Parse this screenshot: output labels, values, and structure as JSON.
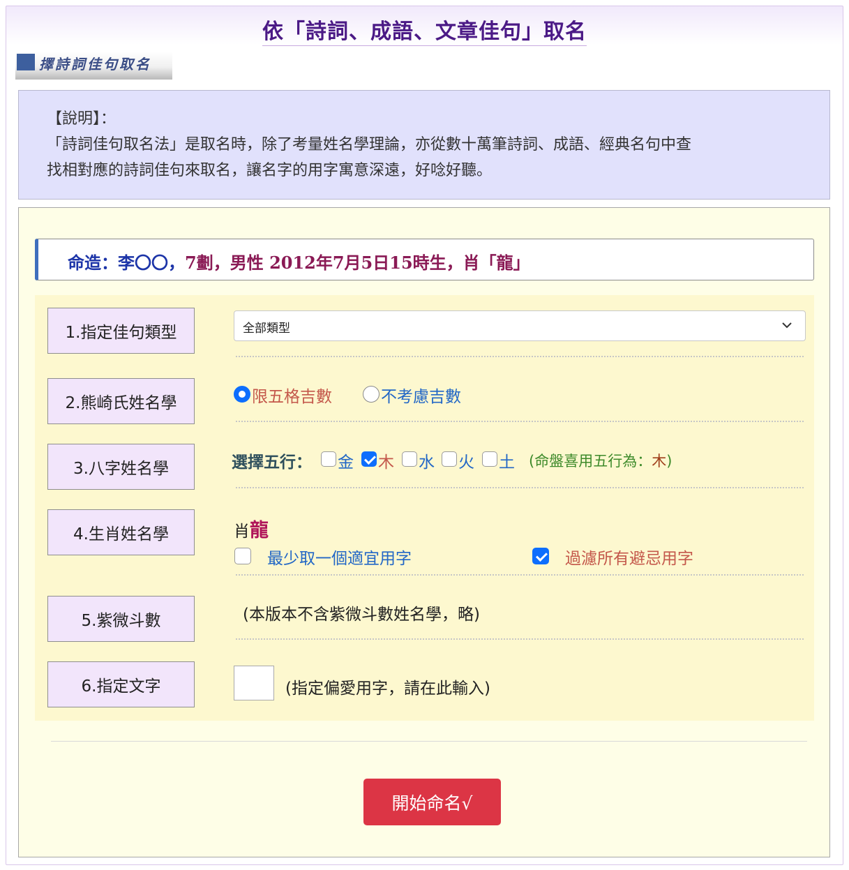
{
  "title": "依「詩詞、成語、文章佳句」取名",
  "banner": {
    "text": "擇詩詞佳句取名"
  },
  "notice": {
    "heading": "【說明】：",
    "line1": "「詩詞佳句取名法」是取名時，除了考量姓名學理論，亦從數十萬筆詩詞、成語、經典名句中查",
    "line2": "找相對應的詩詞佳句來取名，讓名字的用字寓意深遠，好唸好聽。"
  },
  "fate": {
    "prefix": "命造：李〇〇，",
    "strokes": "7劃，",
    "gender": "男性 ",
    "birth": "2012年7月5日15時生，",
    "zodiac": "肖「龍」"
  },
  "rows": {
    "r1": {
      "label": "1.指定佳句類型",
      "select_value": "全部類型"
    },
    "r2": {
      "label": "2.熊崎氏姓名學",
      "opt1": "限五格吉數",
      "opt2": "不考慮吉數",
      "selected": "限五格吉數"
    },
    "r3": {
      "label": "3.八字姓名學",
      "prompt": "選擇五行：",
      "elements": [
        {
          "label": "金",
          "checked": false
        },
        {
          "label": "木",
          "checked": true
        },
        {
          "label": "水",
          "checked": false
        },
        {
          "label": "火",
          "checked": false
        },
        {
          "label": "土",
          "checked": false
        }
      ],
      "hint_prefix": "(命盤喜用五行為：",
      "hint_value": "木",
      "hint_suffix": ")"
    },
    "r4": {
      "label": "4.生肖姓名學",
      "zodiac_prefix": "肖",
      "zodiac_value": "龍",
      "check1": {
        "label": "最少取一個適宜用字",
        "checked": false
      },
      "check2": {
        "label": "過濾所有避忌用字",
        "checked": true
      }
    },
    "r5": {
      "label": "5.紫微斗數",
      "note": "(本版本不含紫微斗數姓名學，略)"
    },
    "r6": {
      "label": "6.指定文字",
      "input_value": "",
      "note": "(指定偏愛用字，請在此輸入)"
    }
  },
  "submit": {
    "label": "開始命名√"
  },
  "colors": {
    "title": "#4b1a86",
    "submit": "#dc3545",
    "notice_bg": "#e1e1fc",
    "form_bg": "#fdf8cf",
    "label_bg": "#f2e5fb"
  },
  "icons": {
    "select": "chevron-down-icon"
  }
}
